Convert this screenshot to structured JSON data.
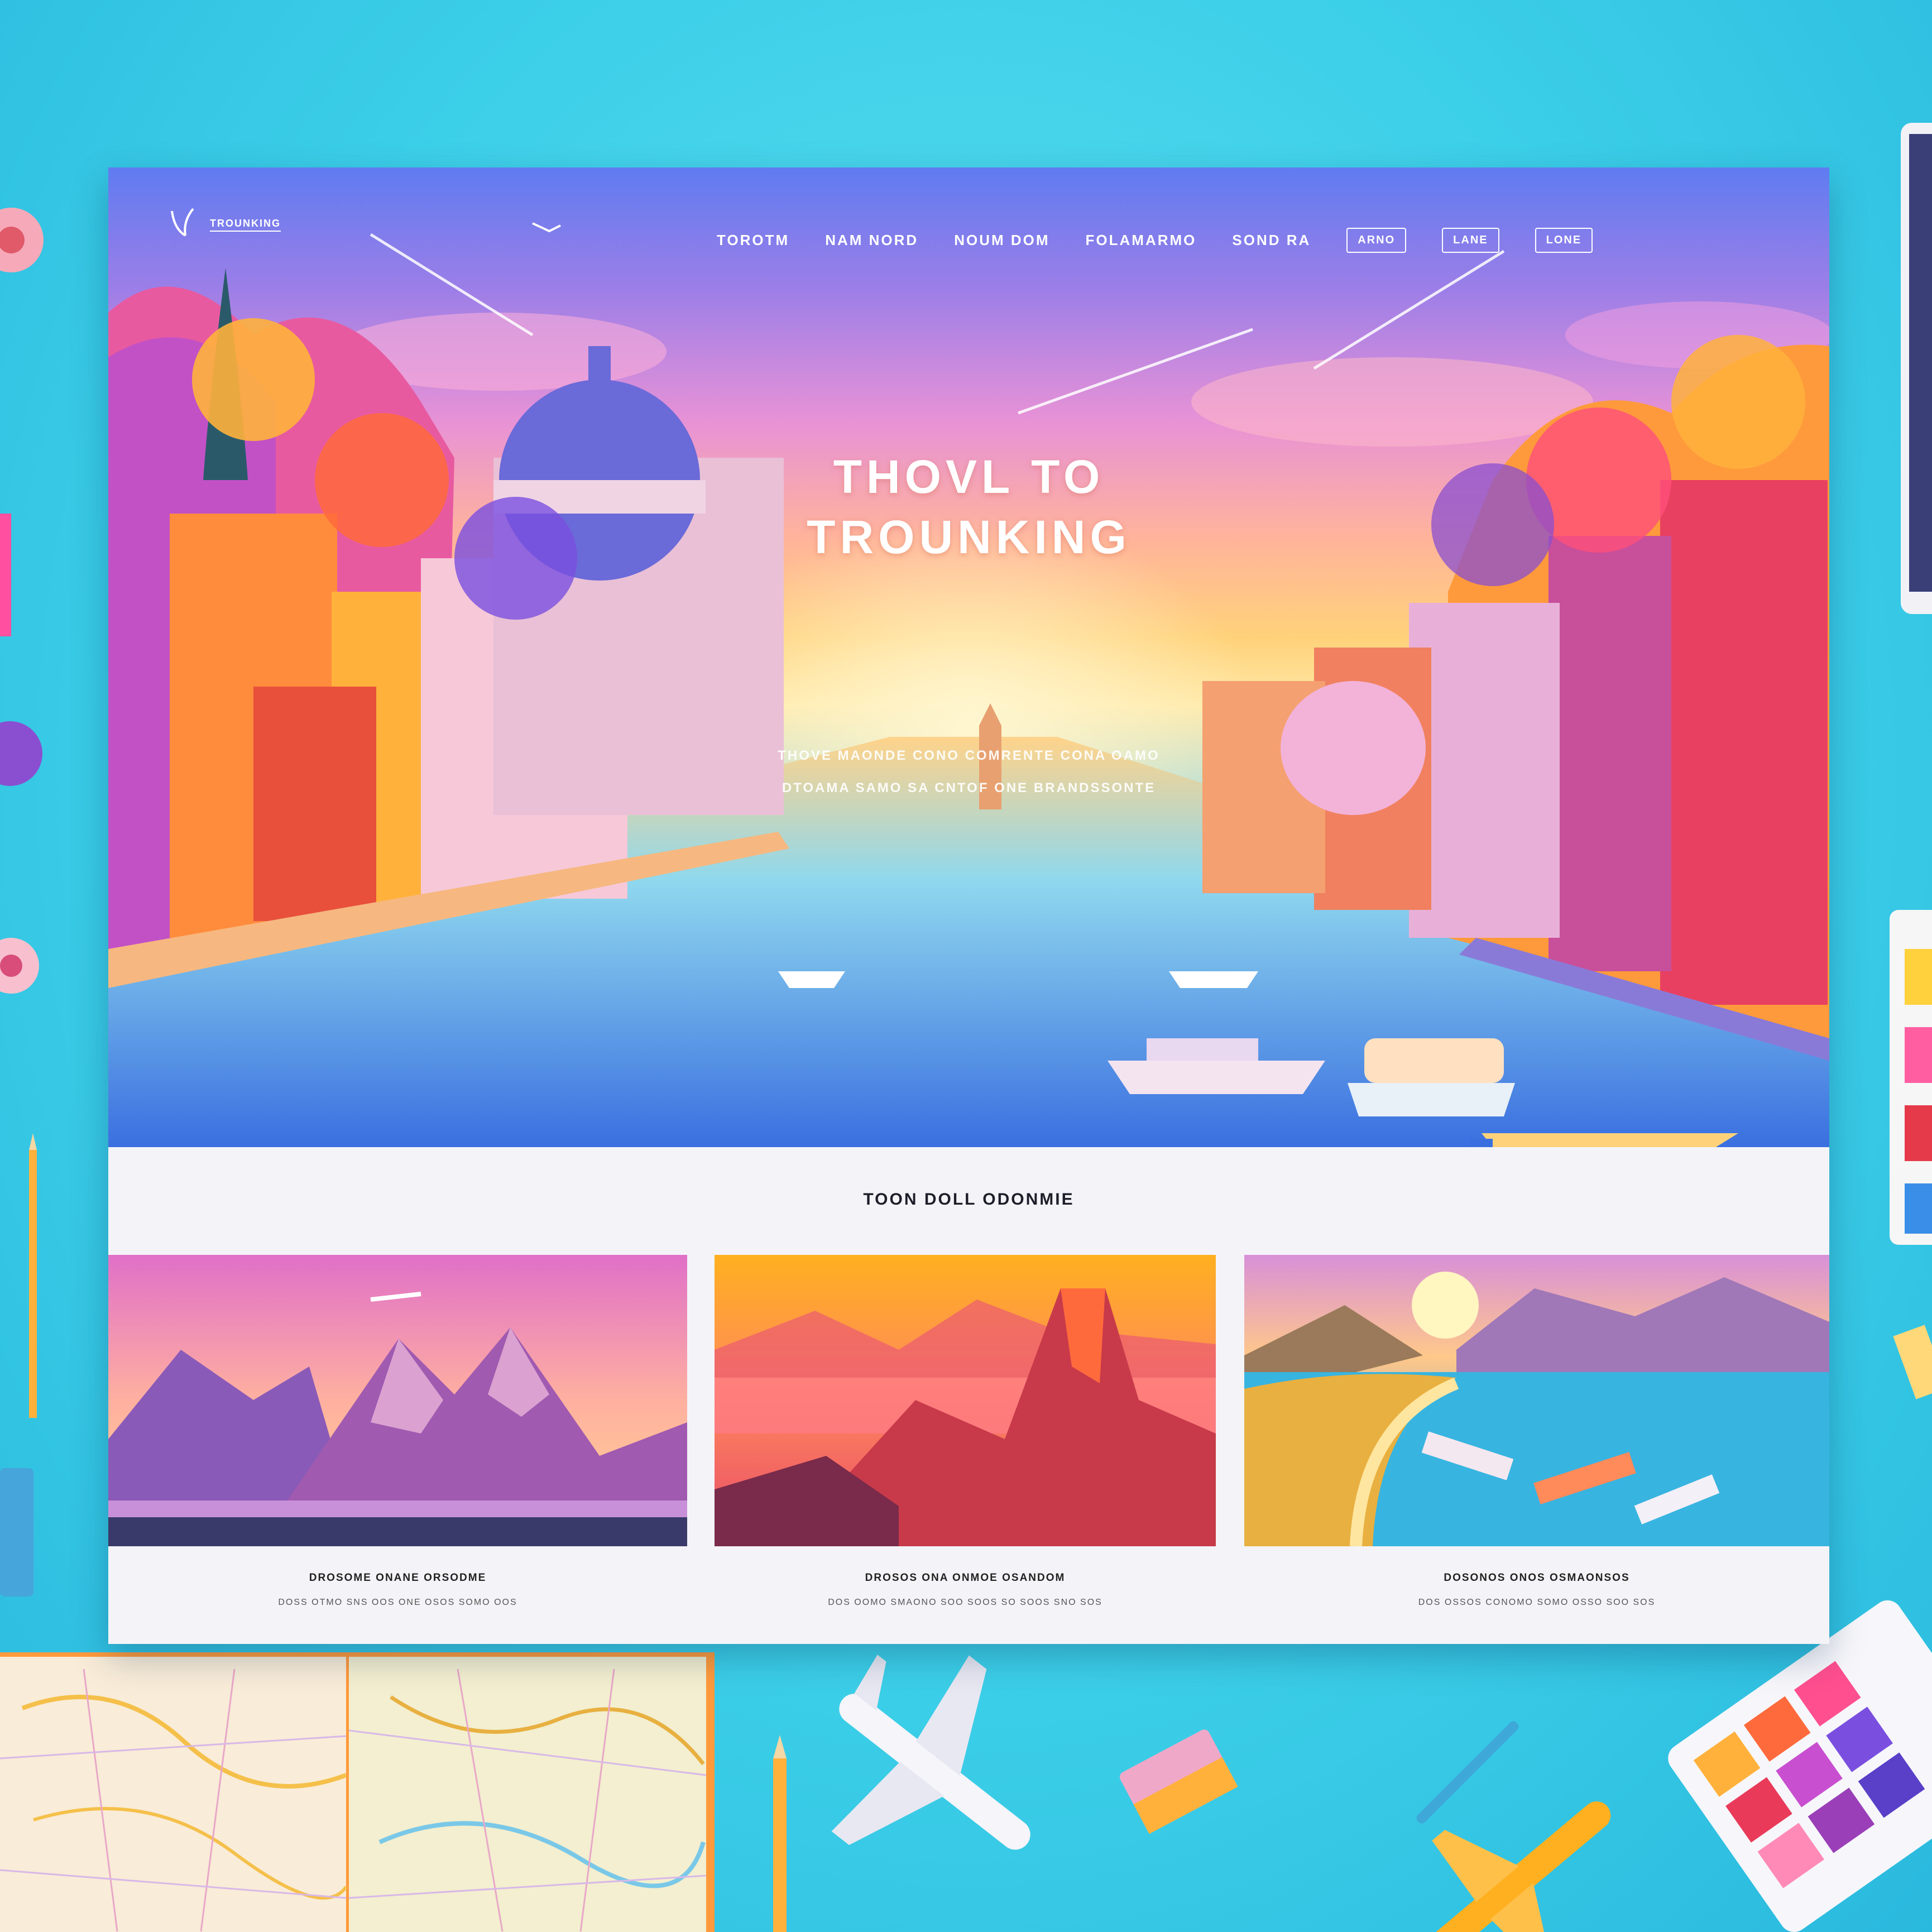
{
  "site": {
    "logo_text": "TROUNKING",
    "colors": {
      "desk": "#3ccfe8",
      "page": "#f4f4f8",
      "accent_pink": "#ff5fb4",
      "accent_orange": "#ffb13c"
    }
  },
  "nav": {
    "links": [
      "TOROTM",
      "NAM NORD",
      "NOUM DOM",
      "FOLAMARMO",
      "SOND RA"
    ],
    "buttons": [
      "ARNO",
      "LANE",
      "LONE"
    ]
  },
  "hero": {
    "title_line1": "THOVL TO",
    "title_line2": "TROUNKING",
    "subtitle_line1": "THOVE MAONDE CONO COMRENTE CONA OAMO",
    "subtitle_line2": "DTOAMA SAMO SA CNTOF ONE BRANDSSONTE"
  },
  "section": {
    "title": "TOON DOLL ODONMIE",
    "cards": [
      {
        "title": "DROSOME ONANE ORSODME",
        "text": "DOSS OTMO SNS OOS ONE OSOS SOMO OOS",
        "icon": "mountains-image"
      },
      {
        "title": "DROSOS ONA ONMOE OSANDOM",
        "text": "DOS OOMO SMAONO SOO SOOS SO SOOS SNO SOS",
        "icon": "red-canyon-image"
      },
      {
        "title": "DOSONOS ONOS OSMAONSOS",
        "text": "DOS OSSOS CONOMO SOMO OSSO SOO SOS",
        "icon": "lake-shore-image"
      }
    ]
  }
}
